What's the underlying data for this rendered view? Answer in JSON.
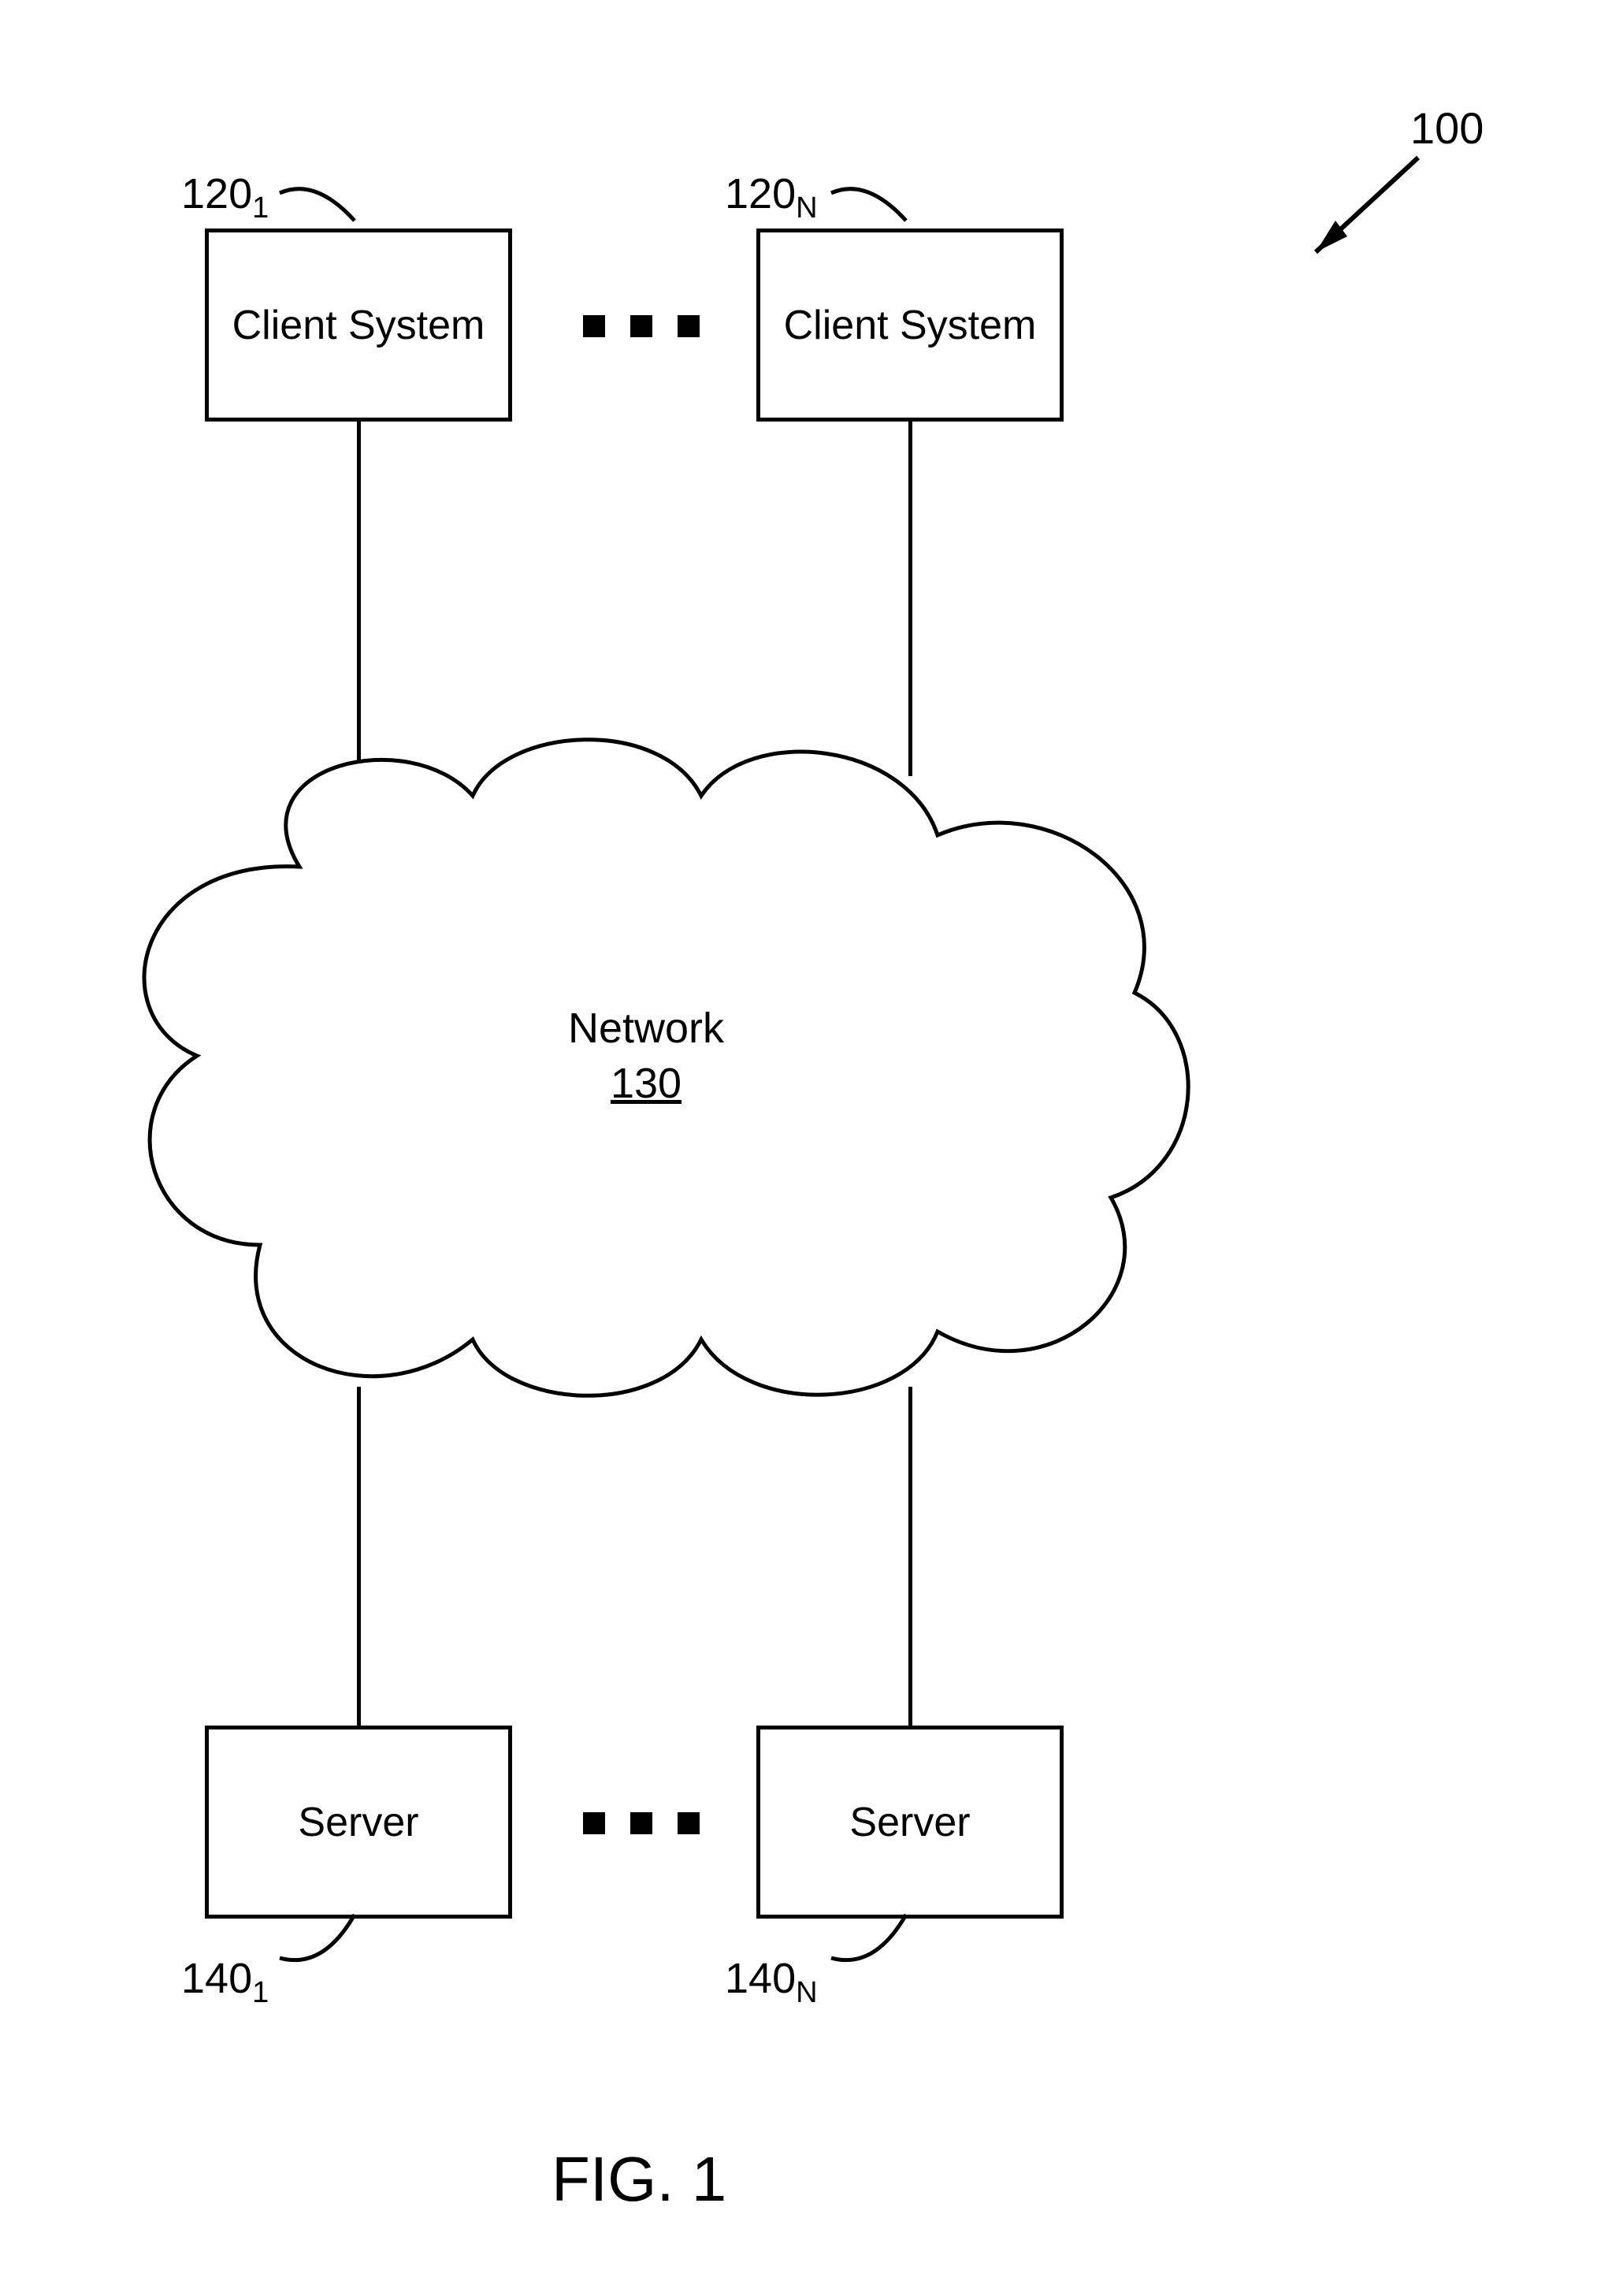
{
  "figure": {
    "ref_label": "100",
    "caption": "FIG. 1",
    "clients": {
      "left": {
        "label": "Client System",
        "ref": "120",
        "ref_sub": "1"
      },
      "right": {
        "label": "Client System",
        "ref": "120",
        "ref_sub": "N"
      }
    },
    "network": {
      "label": "Network",
      "ref": "130"
    },
    "servers": {
      "left": {
        "label": "Server",
        "ref": "140",
        "ref_sub": "1"
      },
      "right": {
        "label": "Server",
        "ref": "140",
        "ref_sub": "N"
      }
    },
    "ellipsis": "…"
  }
}
